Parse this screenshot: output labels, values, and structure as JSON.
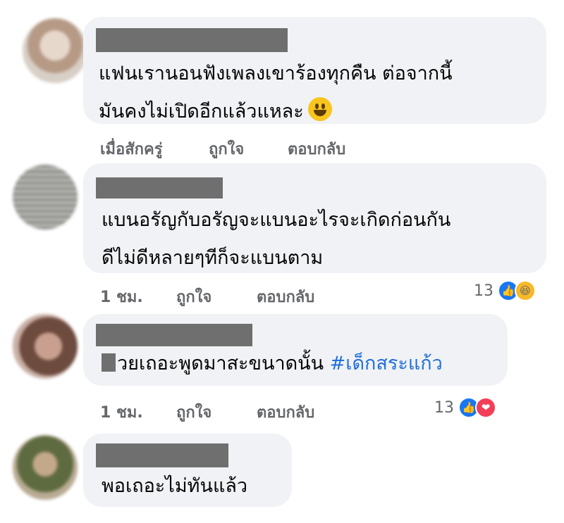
{
  "comments": [
    {
      "text_lines": [
        "แฟนเรานอนฟังเพลงเขาร้องทุกคืน ต่อจากนี้",
        "มันคงไม่เปิดอีกแล้วแหละ"
      ],
      "inline_emoji": "grinning-face",
      "time": "เมื่อสักครู่",
      "like_label": "ถูกใจ",
      "reply_label": "ตอบกลับ",
      "avatar_color": "#c9b7a8"
    },
    {
      "text_lines": [
        "แบนอรัญกับอรัญจะแบนอะไรจะเกิดก่อนกัน",
        "ดีไม่ดีหลายๆทีก็จะแบนตาม"
      ],
      "time": "1 ชม.",
      "like_label": "ถูกใจ",
      "reply_label": "ตอบกลับ",
      "reaction_count": "13",
      "reactions": [
        "like",
        "haha"
      ],
      "avatar_color": "#9b9b98"
    },
    {
      "text_after_redaction": "วยเถอะพูดมาสะขนาดนั้น",
      "hashtag": "#เด็กสระแก้ว",
      "time": "1 ชม.",
      "like_label": "ถูกใจ",
      "reply_label": "ตอบกลับ",
      "reaction_count": "13",
      "reactions": [
        "like",
        "love"
      ],
      "avatar_color": "#a0786a"
    },
    {
      "text_lines": [
        "พอเถอะไม่ทันแล้ว"
      ],
      "avatar_color": "#7d8560"
    }
  ],
  "colors": {
    "bubble": "#f0f2f5",
    "meta_text": "#65676b",
    "hashtag": "#216fdb",
    "like": "#1877f2",
    "love": "#f33e58",
    "haha": "#f7b928"
  }
}
